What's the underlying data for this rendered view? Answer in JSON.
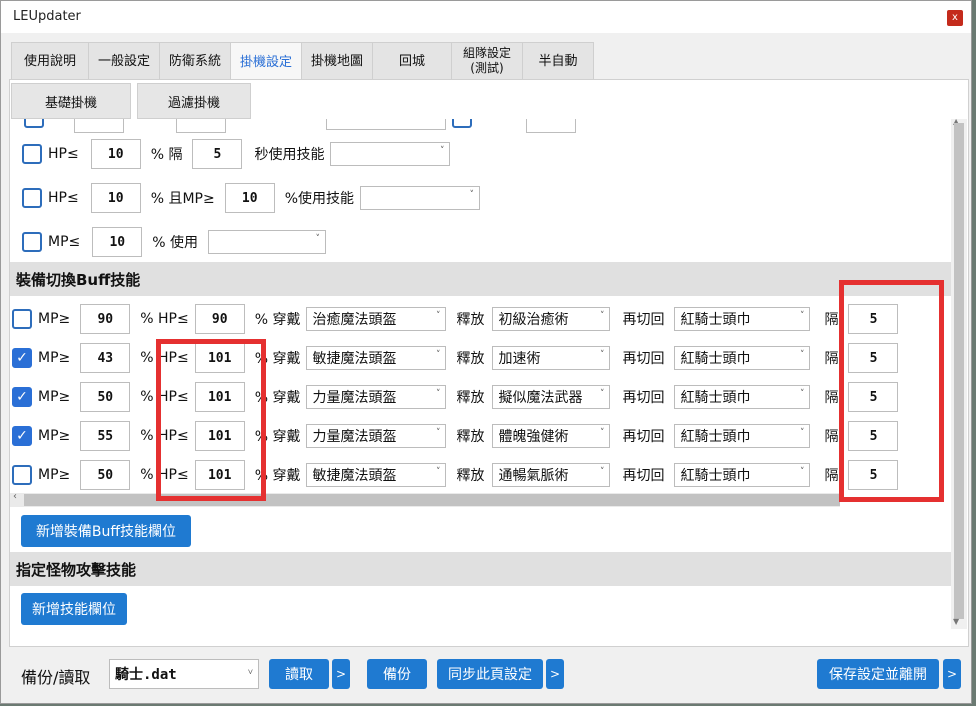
{
  "window": {
    "title": "LEUpdater",
    "close_label": "x"
  },
  "tabs": [
    {
      "label": "使用說明"
    },
    {
      "label": "一般設定"
    },
    {
      "label": "防衛系統"
    },
    {
      "label": "掛機設定"
    },
    {
      "label": "掛機地圖"
    },
    {
      "label": "回城"
    },
    {
      "label": "組隊設定\n(測試)"
    },
    {
      "label": "半自動"
    }
  ],
  "subtabs": {
    "basic": "基礎掛機",
    "filter": "過濾掛機"
  },
  "hp_rules": {
    "row1": {
      "hp_label": "HP≤",
      "hp_value": "10",
      "pct_label": "% 隔",
      "interval_value": "5",
      "suffix": "秒使用技能",
      "skill": ""
    },
    "row2": {
      "hp_label": "HP≤",
      "hp_value": "10",
      "pct_label": "% 且MP≥",
      "mp_value": "10",
      "suffix": "%使用技能",
      "skill": ""
    },
    "row3": {
      "mp_label": "MP≤",
      "mp_value": "10",
      "suffix": "% 使用",
      "skill": ""
    }
  },
  "equip_section": {
    "title": "裝備切換Buff技能",
    "labels": {
      "mp": "MP≥",
      "hp": "% HP≤",
      "wear": "% 穿戴",
      "release": "釋放",
      "switch_back": "再切回",
      "interval": "隔"
    },
    "rows": [
      {
        "checked": false,
        "mp": "90",
        "hp": "90",
        "equip": "治癒魔法頭盔",
        "skill": "初級治癒術",
        "back": "紅騎士頭巾",
        "interval": "5"
      },
      {
        "checked": true,
        "mp": "43",
        "hp": "101",
        "equip": "敏捷魔法頭盔",
        "skill": "加速術",
        "back": "紅騎士頭巾",
        "interval": "5"
      },
      {
        "checked": true,
        "mp": "50",
        "hp": "101",
        "equip": "力量魔法頭盔",
        "skill": "擬似魔法武器",
        "back": "紅騎士頭巾",
        "interval": "5"
      },
      {
        "checked": true,
        "mp": "55",
        "hp": "101",
        "equip": "力量魔法頭盔",
        "skill": "體魄強健術",
        "back": "紅騎士頭巾",
        "interval": "5"
      },
      {
        "checked": false,
        "mp": "50",
        "hp": "101",
        "equip": "敏捷魔法頭盔",
        "skill": "通暢氣脈術",
        "back": "紅騎士頭巾",
        "interval": "5"
      }
    ],
    "add_button": "新增裝備Buff技能欄位"
  },
  "monster_section": {
    "title": "指定怪物攻擊技能",
    "add_button": "新增技能欄位"
  },
  "bottom": {
    "backup_label": "備份/讀取",
    "file_value": "騎士.dat",
    "read_button": "讀取",
    "more_button": ">",
    "backup_button": "備份",
    "sync_button": "同步此頁設定",
    "save_exit_button": "保存設定並離開"
  },
  "colors": {
    "accent": "#1f7ad1",
    "highlight_box": "#e53030",
    "active_tab_text": "#2a6fd6"
  }
}
